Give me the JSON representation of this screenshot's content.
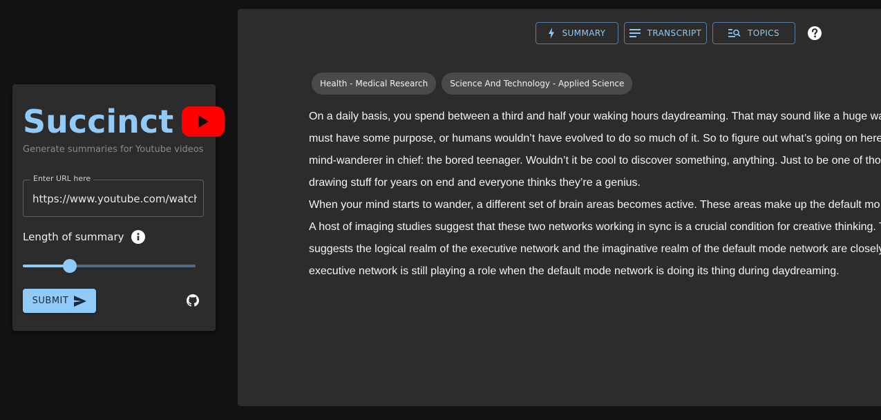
{
  "sidebar": {
    "brand_name": "Succinct",
    "tagline": "Generate summaries for Youtube videos",
    "url_label": "Enter URL here",
    "url_value": "https://www.youtube.com/watch",
    "length_label": "Length of summary",
    "length_value": 0.27,
    "submit_label": "SUBMIT"
  },
  "tabs": [
    {
      "label": "SUMMARY",
      "icon": "bolt-icon"
    },
    {
      "label": "TRANSCRIPT",
      "icon": "lines-icon"
    },
    {
      "label": "TOPICS",
      "icon": "list-search-icon"
    }
  ],
  "topics": [
    "Health - Medical Research",
    "Science And Technology - Applied Science"
  ],
  "transcript_lines": [
    "On a daily basis, you spend between a third and half your waking hours daydreaming. That may sound like a huge wa",
    "must have some purpose, or humans wouldn’t have evolved to do so much of it. So to figure out what’s going on here",
    "mind-wanderer in chief: the bored teenager. Wouldn’t it be cool to discover something, anything. Just to be one of tho",
    "drawing stuff for years on end and everyone thinks they’re a genius.",
    "When your mind starts to wander, a different set of brain areas becomes active. These areas make up the default mo",
    "A host of imaging studies suggest that these two networks working in sync is a crucial condition for creative thinking. T",
    "suggests the logical realm of the executive network and the imaginative realm of the default mode network are closely",
    "executive network is still playing a role when the default mode network is doing its thing during daydreaming."
  ],
  "colors": {
    "accent": "#90caf9",
    "background": "#121212",
    "panel": "#2c2c2c",
    "chip": "#4a4a4a",
    "youtube_red": "#ff0000"
  }
}
